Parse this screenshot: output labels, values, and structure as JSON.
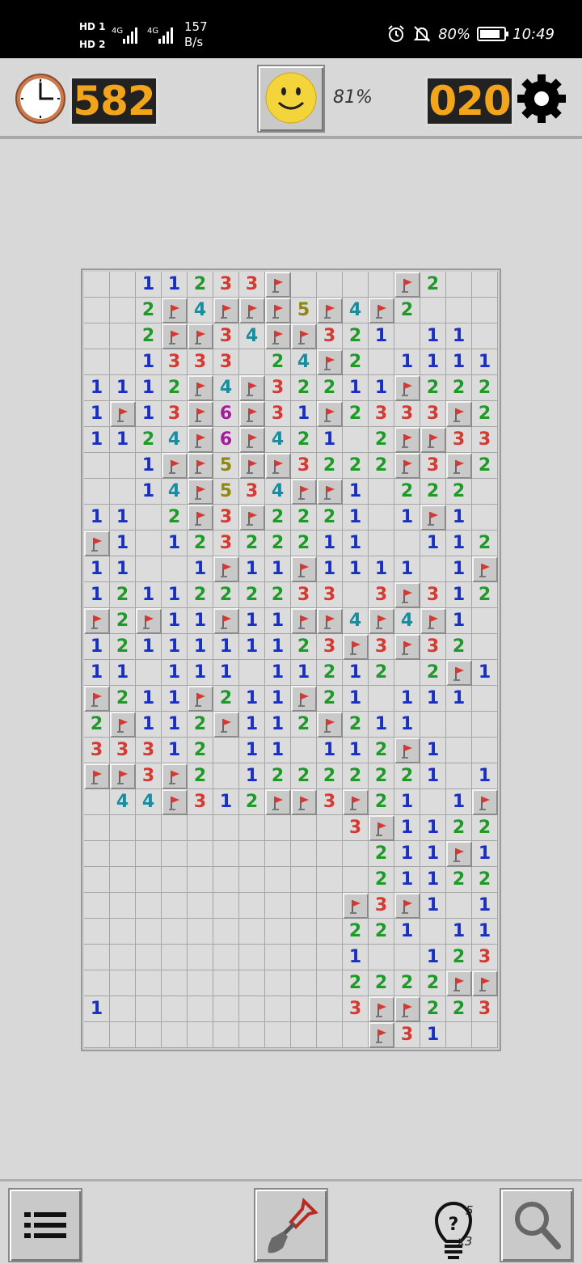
{
  "status_bar": {
    "hd1": "HD 1",
    "hd2": "HD 2",
    "net1": "4G",
    "net2": "4G",
    "speed_value": "157",
    "speed_unit": "B/s",
    "battery": "80%",
    "time": "10:49",
    "icons": [
      "alarm-icon",
      "mute-icon",
      "battery-icon"
    ]
  },
  "header": {
    "timer": "582",
    "progress": "81%",
    "mines_left": "020",
    "icons": [
      "clock-icon",
      "smiley-icon",
      "gear-icon"
    ]
  },
  "board": {
    "columns": 16,
    "rows": [
      "..11233F....F2...",
      "..2F4FFF5F4F2...",
      "..2FF34FF321.11",
      "..1333.24F2.1111F",
      "1112F4F32211F222",
      "1F13F6F31F2333F2",
      "1124F6F421.2FF33F",
      "..1FF5FF3222F3F21",
      "..14F534FF1.222.",
      "11.2F3F2221.1F1.",
      "F1.12322211..1121",
      "11..1F11F1111.1F",
      "1211222233.3F3121",
      "F2F11F11FF4F4F1.",
      "1211111123F3F32.",
      "11.111.11212.2F1",
      "F211F211F21.111.",
      "2F112F112F211...",
      "33312.11.112F1...",
      "FF3F2.12222221.11",
      ".44F312FF3F21.1F",
      "..........3F1122",
      "...........211F1",
      "...........2112 2",
      "..........F3F1.1F",
      "..........221.11",
      "..........1..1232",
      "..........2222FFF",
      "1.........3FF2232",
      "...........F31..."
    ],
    "flag_icon": "flag-icon"
  },
  "toolbar": {
    "hints_count": "5",
    "hints_multiplier": "x3",
    "icons": [
      "menu-icon",
      "shovel-icon",
      "lightbulb-icon",
      "magnifier-icon"
    ]
  },
  "colors": {
    "n1": "#1a2fc4",
    "n2": "#1f9a2a",
    "n3": "#d23a32",
    "n4": "#198ea0",
    "n5": "#8e8716",
    "n6": "#a31d9e",
    "counter": "#f2a41a"
  }
}
